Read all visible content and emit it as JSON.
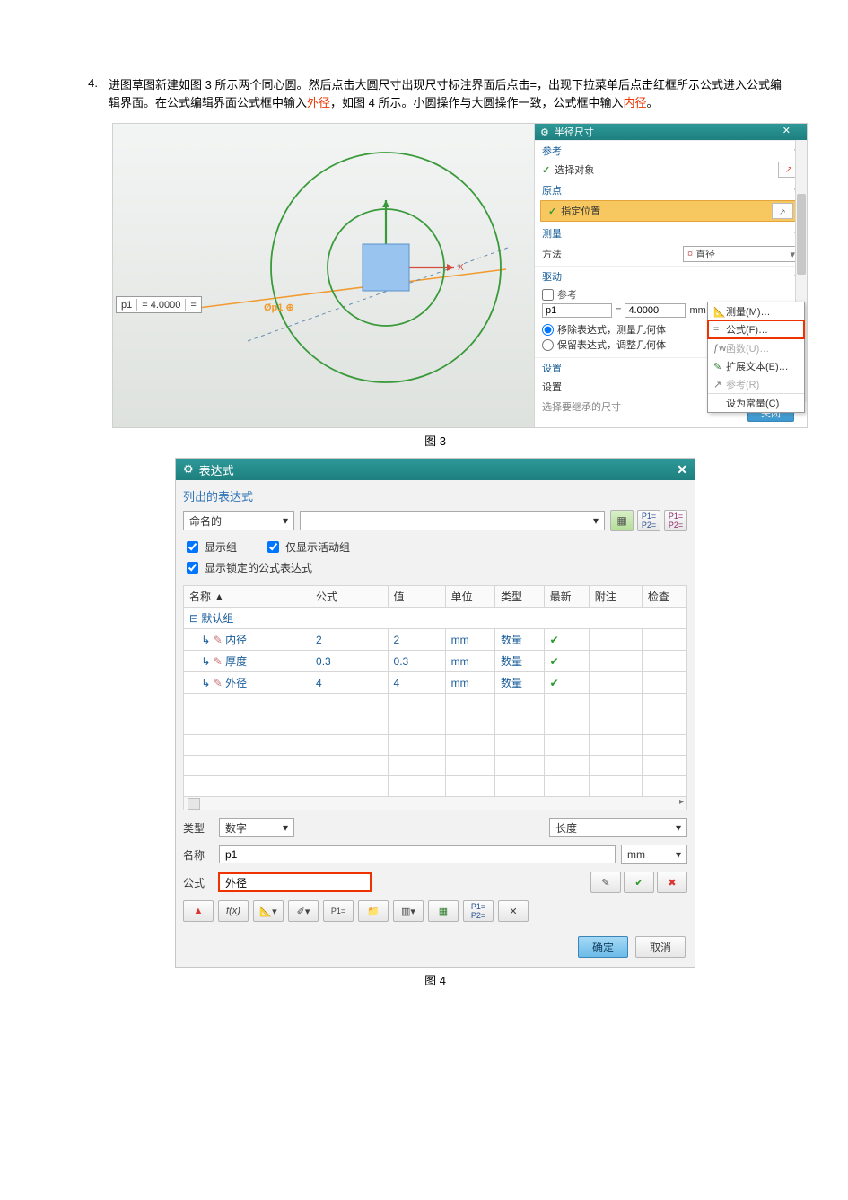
{
  "step": {
    "num": "4.",
    "t1": "进图草图新建如图 3 所示两个同心圆。然后点击大圆尺寸出现尺寸标注界面后点击=，出现下拉菜单后点击红框所示公式进入公式编辑界面。在公式编辑界面公式框中输入",
    "r1": "外径",
    "t2": "，如图 4 所示。小圆操作与大圆操作一致，公式框中输入",
    "r2": "内径",
    "t3": "。"
  },
  "fig3": {
    "caption": "图 3",
    "dim_label": "Øp1 ⊕",
    "p1_name": "p1",
    "p1_val": "= 4.0000",
    "panel": {
      "title": "半径尺寸",
      "sec_ref": "参考",
      "sel_obj": "选择对象",
      "sec_origin": "原点",
      "spec_pos": "指定位置",
      "sec_measure": "测量",
      "method": "方法",
      "method_val": "直径",
      "sec_drive": "驱动",
      "ref_chk": "参考",
      "drive_name": "p1",
      "drive_eq": "=",
      "drive_val": "4.0000",
      "drive_unit": "mm",
      "drive_btn": "=",
      "radio1": "移除表达式，测量几何体",
      "radio2": "保留表达式，调整几何体",
      "sec_settings": "设置",
      "setting_line": "设置",
      "hint": "选择要继承的尺寸",
      "close": "关闭"
    },
    "ctx": {
      "m1": "测量(M)…",
      "m2": "公式(F)…",
      "m3": "函数(U)…",
      "m4": "扩展文本(E)…",
      "m5": "参考(R)",
      "m6": "设为常量(C)"
    }
  },
  "fig4": {
    "caption": "图 4",
    "title": "表达式",
    "section_title": "列出的表达式",
    "named": "命名的",
    "chk1": "显示组",
    "chk2": "仅显示活动组",
    "chk3": "显示锁定的公式表达式",
    "cols": {
      "name": "名称  ▲",
      "formula": "公式",
      "value": "值",
      "unit": "单位",
      "type": "类型",
      "newest": "最新",
      "note": "附注",
      "check": "检查"
    },
    "group": "默认组",
    "rows": [
      {
        "name": "内径",
        "formula": "2",
        "value": "2",
        "unit": "mm",
        "type": "数量"
      },
      {
        "name": "厚度",
        "formula": "0.3",
        "value": "0.3",
        "unit": "mm",
        "type": "数量"
      },
      {
        "name": "外径",
        "formula": "4",
        "value": "4",
        "unit": "mm",
        "type": "数量"
      }
    ],
    "type_lbl": "类型",
    "type_val": "数字",
    "dim_group": "长度",
    "name_lbl": "名称",
    "name_val": "p1",
    "name_unit": "mm",
    "formula_lbl": "公式",
    "formula_val": "外径",
    "ok": "确定",
    "cancel": "取消"
  }
}
